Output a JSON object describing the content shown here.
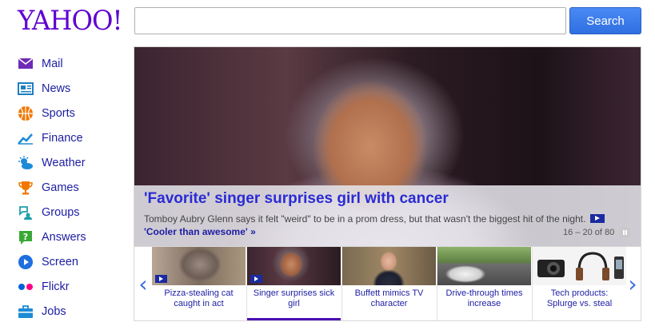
{
  "logo": "YAHOO!",
  "search": {
    "placeholder": "",
    "button_label": "Search"
  },
  "sidebar": {
    "items": [
      {
        "label": "Mail",
        "icon": "envelope-icon",
        "color": "#6e2bb6"
      },
      {
        "label": "News",
        "icon": "newspaper-icon",
        "color": "#1d7fc1"
      },
      {
        "label": "Sports",
        "icon": "basketball-icon",
        "color": "#f07800"
      },
      {
        "label": "Finance",
        "icon": "chart-icon",
        "color": "#1d8bd6"
      },
      {
        "label": "Weather",
        "icon": "sun-cloud-icon",
        "color": "#1d8bd6"
      },
      {
        "label": "Games",
        "icon": "trophy-icon",
        "color": "#f07800"
      },
      {
        "label": "Groups",
        "icon": "groups-icon",
        "color": "#1d9ea8"
      },
      {
        "label": "Answers",
        "icon": "question-icon",
        "color": "#3aa835"
      },
      {
        "label": "Screen",
        "icon": "play-circle-icon",
        "color": "#1d6fe0"
      },
      {
        "label": "Flickr",
        "icon": "flickr-dots-icon",
        "color": "#ff0084"
      },
      {
        "label": "Jobs",
        "icon": "briefcase-icon",
        "color": "#1d8bd6"
      }
    ]
  },
  "hero": {
    "title": "'Favorite' singer surprises girl with cancer",
    "description": "Tomboy Aubry Glenn says it felt \"weird\" to be in a prom dress, but that wasn't the biggest hit of the night.",
    "link": "'Cooler than awesome' »",
    "counter": "16 – 20 of 80"
  },
  "carousel": {
    "items": [
      {
        "caption": "Pizza-stealing cat caught in act",
        "video": true,
        "active": false
      },
      {
        "caption": "Singer surprises sick girl",
        "video": true,
        "active": true
      },
      {
        "caption": "Buffett mimics TV character",
        "video": false,
        "active": false
      },
      {
        "caption": "Drive-through times increase",
        "video": false,
        "active": false
      },
      {
        "caption": "Tech products: Splurge vs. steal",
        "video": false,
        "active": false
      }
    ]
  }
}
